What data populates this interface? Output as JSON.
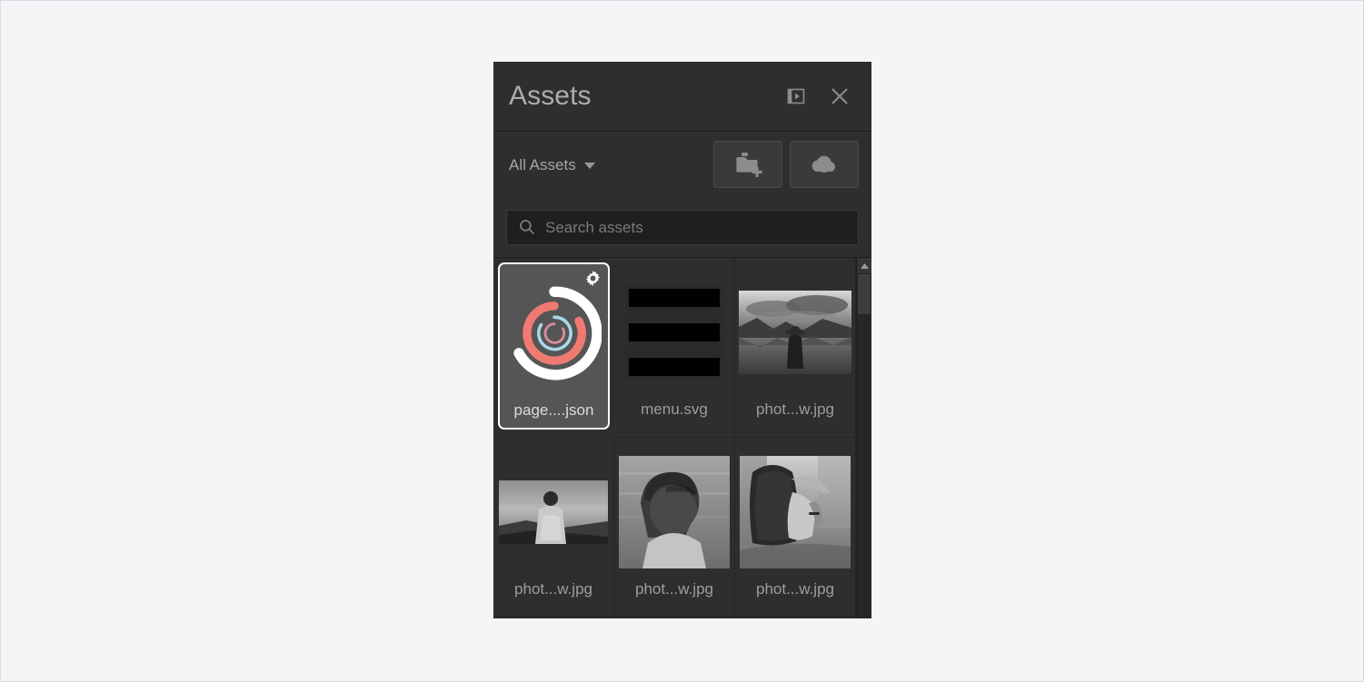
{
  "panel": {
    "title": "Assets",
    "dock_icon": "panel-dock-icon",
    "close_icon": "close-icon"
  },
  "toolbar": {
    "filter_label": "All Assets",
    "filter_caret_icon": "chevron-down-icon",
    "new_folder_icon": "new-folder-icon",
    "upload_icon": "cloud-upload-icon"
  },
  "search": {
    "placeholder": "Search assets",
    "value": "",
    "icon": "search-icon"
  },
  "assets": [
    {
      "name": "page....json",
      "type": "json",
      "thumb": "loading-rings",
      "selected": true,
      "gear_icon": "gear-icon"
    },
    {
      "name": "menu.svg",
      "type": "svg",
      "thumb": "hamburger-bars",
      "selected": false
    },
    {
      "name": "phot...w.jpg",
      "type": "jpg",
      "thumb": "photo-lake-person",
      "selected": false
    },
    {
      "name": "phot...w.jpg",
      "type": "jpg",
      "thumb": "photo-man-back-sunset",
      "selected": false
    },
    {
      "name": "phot...w.jpg",
      "type": "jpg",
      "thumb": "photo-man-profile-water",
      "selected": false
    },
    {
      "name": "phot...w.jpg",
      "type": "jpg",
      "thumb": "photo-woman-back-hair",
      "selected": false
    }
  ],
  "scrollbar": {
    "up_arrow_icon": "scroll-up-arrow-icon",
    "thumb_position_pct": 0,
    "thumb_size_pct": 52
  },
  "colors": {
    "panel_bg": "#2e2e2e",
    "header_bg": "#2e2e2e",
    "search_bg": "#1f1f1f",
    "selection_bg": "#555555",
    "selection_border": "#ffffff",
    "text_primary": "#adadad",
    "text_muted": "#9d9d9d",
    "icon": "#8c8c8c",
    "page_bg": "#f4f5f7",
    "ring_white": "#ffffff",
    "ring_red": "#f07a72",
    "ring_blue": "#a8d8ea",
    "ring_pink": "#d98f9e"
  }
}
